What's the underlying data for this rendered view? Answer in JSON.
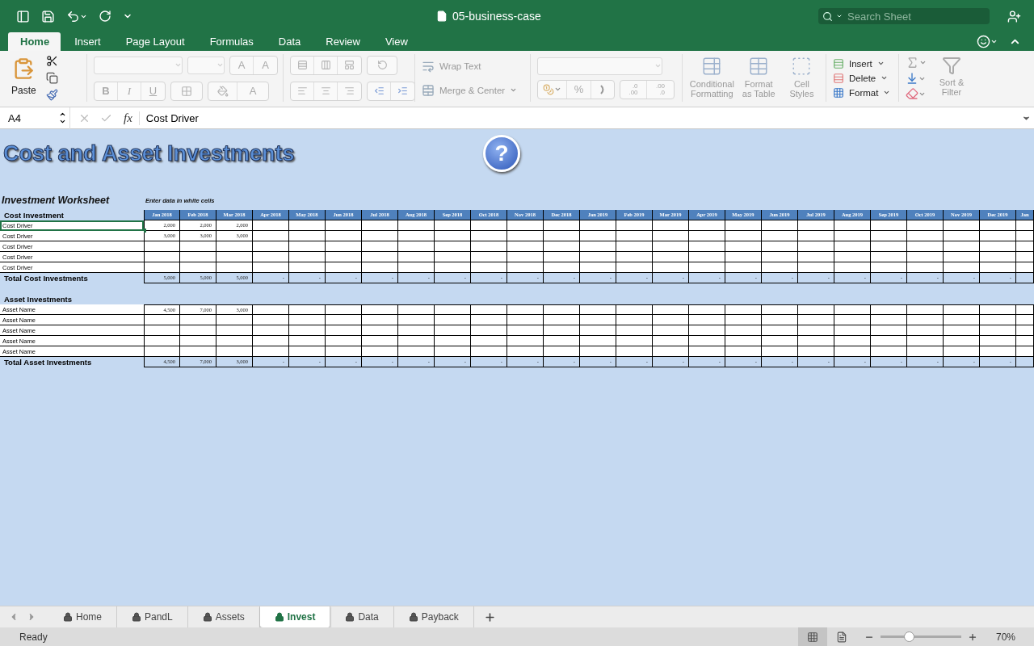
{
  "title_bar": {
    "document_title": "05-business-case",
    "search": {
      "placeholder": "Search Sheet"
    }
  },
  "ribbon_tabs": [
    {
      "label": "Home",
      "selected": true
    },
    {
      "label": "Insert",
      "selected": false
    },
    {
      "label": "Page Layout",
      "selected": false
    },
    {
      "label": "Formulas",
      "selected": false
    },
    {
      "label": "Data",
      "selected": false
    },
    {
      "label": "Review",
      "selected": false
    },
    {
      "label": "View",
      "selected": false
    }
  ],
  "ribbon": {
    "clipboard": {
      "paste": "Paste"
    },
    "font": {
      "disabled": true,
      "size_buttons": [
        "A",
        "A"
      ],
      "style_buttons": [
        "B",
        "I",
        "U"
      ],
      "color_button": "A"
    },
    "alignment": {
      "disabled": true,
      "wrap_text": "Wrap Text",
      "merge_center": "Merge & Center"
    },
    "number": {
      "disabled": true,
      "percent": "%",
      "decimal_buttons": [
        {
          "top": ".0",
          "bottom": ".00"
        },
        {
          "top": ".00",
          "bottom": ".0"
        }
      ]
    },
    "styles": {
      "disabled": true,
      "buttons": [
        "Conditional Formatting",
        "Format as Table",
        "Cell Styles"
      ]
    },
    "cells": {
      "disabled": false,
      "buttons": [
        "Insert",
        "Delete",
        "Format"
      ]
    },
    "editing": {
      "disabled": true,
      "sort_filter": "Sort & Filter"
    }
  },
  "formula_bar": {
    "name_box": "A4",
    "fx": "fx",
    "value": "Cost Driver"
  },
  "sheet": {
    "title": "Cost and Asset Investments",
    "help": "?",
    "subtitle": "Investment Worksheet",
    "note": "Enter data in white cells",
    "months": [
      "Jan 2018",
      "Feb 2018",
      "Mar 2018",
      "Apr 2018",
      "May 2018",
      "Jun 2018",
      "Jul 2018",
      "Aug 2018",
      "Sep 2018",
      "Oct 2018",
      "Nov 2018",
      "Dec 2018",
      "Jan 2019",
      "Feb 2019",
      "Mar 2019",
      "Apr 2019",
      "May 2019",
      "Jun 2019",
      "Jul 2019",
      "Aug 2019",
      "Sep 2019",
      "Oct 2019",
      "Nov 2019",
      "Dec 2019",
      "Jan"
    ],
    "sections": [
      {
        "title": "Cost Investment",
        "show_months": true,
        "rows": [
          {
            "label": "Cost Driver",
            "selected": true,
            "values": [
              "2,000",
              "2,000",
              "2,000"
            ]
          },
          {
            "label": "Cost Driver",
            "selected": false,
            "values": [
              "3,000",
              "3,000",
              "3,000"
            ]
          },
          {
            "label": "Cost Driver",
            "selected": false,
            "values": []
          },
          {
            "label": "Cost Driver",
            "selected": false,
            "values": []
          },
          {
            "label": "Cost Driver",
            "selected": false,
            "values": []
          }
        ],
        "total": {
          "label": "Total Cost Investments",
          "values": [
            "5,000",
            "5,000",
            "5,000",
            "-",
            "-",
            "-",
            "-",
            "-",
            "-",
            "-",
            "-",
            "-",
            "-",
            "-",
            "-",
            "-",
            "-",
            "-",
            "-",
            "-",
            "-",
            "-",
            "-",
            "-"
          ]
        }
      },
      {
        "title": "Asset Investments",
        "show_months": false,
        "rows": [
          {
            "label": "Asset Name",
            "selected": false,
            "values": [
              "4,500",
              "7,000",
              "3,000"
            ]
          },
          {
            "label": "Asset Name",
            "selected": false,
            "values": []
          },
          {
            "label": "Asset Name",
            "selected": false,
            "values": []
          },
          {
            "label": "Asset Name",
            "selected": false,
            "values": []
          },
          {
            "label": "Asset Name",
            "selected": false,
            "values": []
          }
        ],
        "total": {
          "label": "Total Asset Investments",
          "values": [
            "4,500",
            "7,000",
            "3,000",
            "-",
            "-",
            "-",
            "-",
            "-",
            "-",
            "-",
            "-",
            "-",
            "-",
            "-",
            "-",
            "-",
            "-",
            "-",
            "-",
            "-",
            "-",
            "-",
            "-",
            "-"
          ]
        }
      }
    ]
  },
  "sheet_tabs": [
    {
      "label": "Home",
      "selected": false
    },
    {
      "label": "PandL",
      "selected": false
    },
    {
      "label": "Assets",
      "selected": false
    },
    {
      "label": "Invest",
      "selected": true
    },
    {
      "label": "Data",
      "selected": false
    },
    {
      "label": "Payback",
      "selected": false
    }
  ],
  "status_bar": {
    "status": "Ready",
    "views": [
      {
        "kind": "normal",
        "selected": true
      },
      {
        "kind": "page_layout",
        "selected": false
      }
    ],
    "zoom": {
      "level": 0.35,
      "reading": "70%"
    }
  }
}
